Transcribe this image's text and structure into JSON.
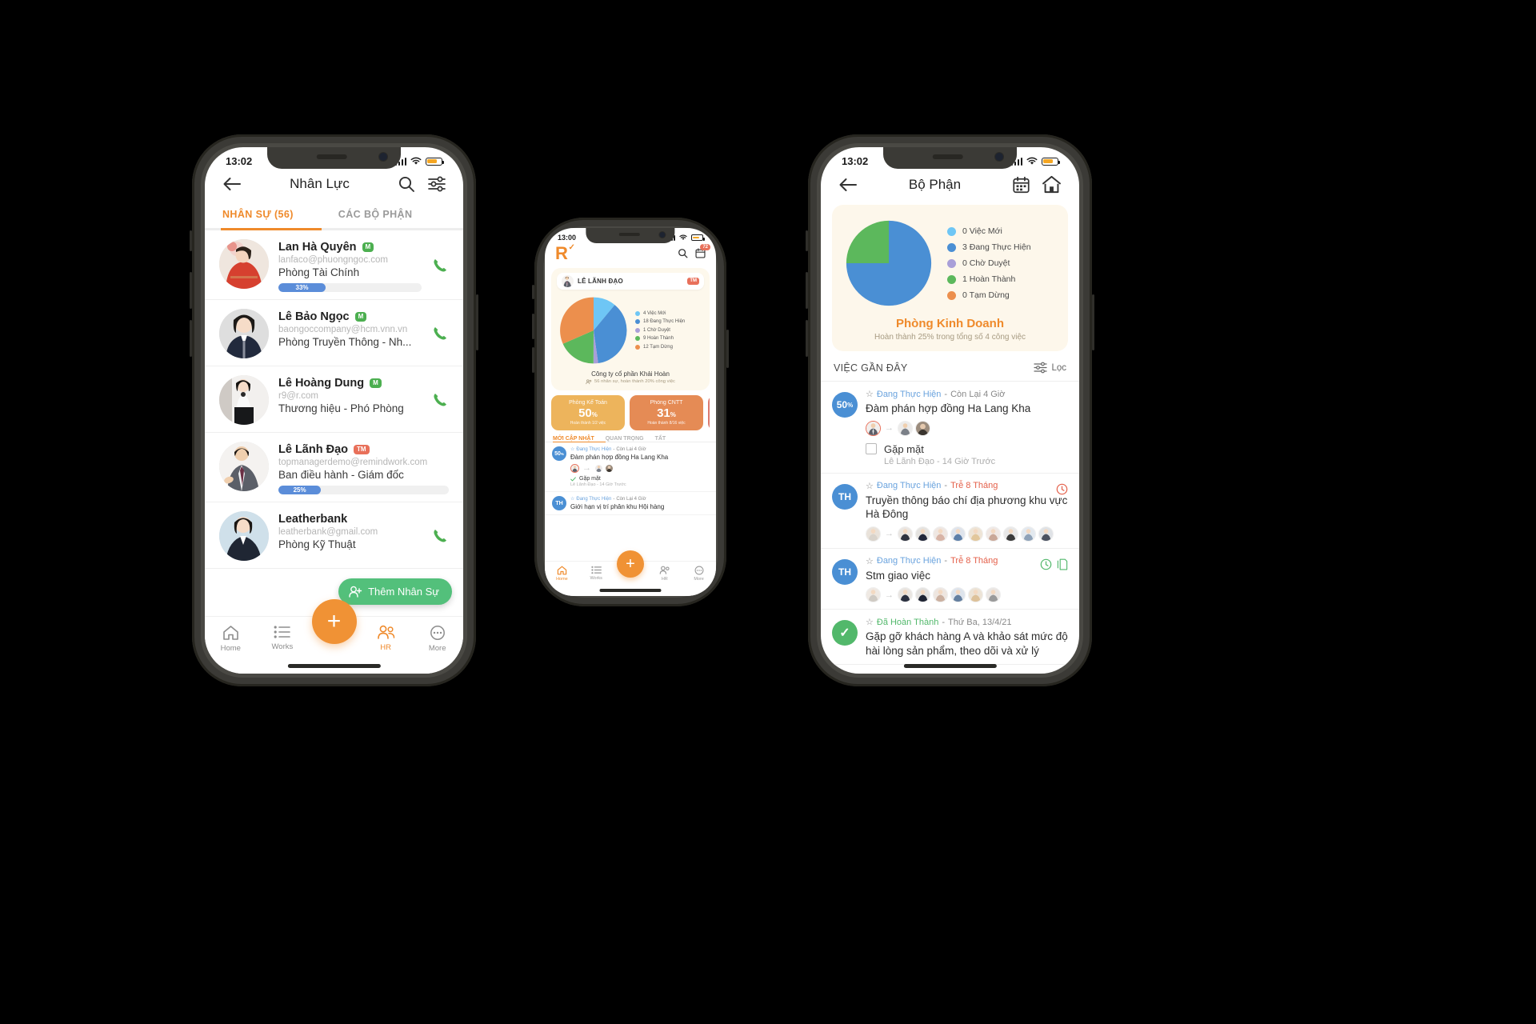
{
  "colors": {
    "orange": "#ef8a2b",
    "green": "#53c07b",
    "blue": "#4a8fd4",
    "light_blue": "#6ec6f5",
    "purple": "#a99fd8",
    "pie_green": "#5cb85c",
    "pie_orange": "#ec8f4d",
    "red": "#e4604a",
    "cream": "#fdf7eb"
  },
  "left_phone": {
    "status": {
      "time": "13:02"
    },
    "header": {
      "title": "Nhân Lực",
      "back_icon": "back-arrow-icon",
      "search_icon": "search-icon",
      "filter_icon": "filter-icon"
    },
    "tabs": [
      {
        "label": "NHÂN SỰ (56)",
        "active": true
      },
      {
        "label": "CÁC BỘ PHẬN",
        "active": false
      }
    ],
    "people": [
      {
        "name": "Lan Hà Quyên",
        "badge": "M",
        "badge_type": "m",
        "email": "lanfaco@phuongngoc.com",
        "dept": "Phòng Tài Chính",
        "progress": 33,
        "progress_label": "33%",
        "has_progress": true,
        "has_phone": true
      },
      {
        "name": "Lê Bảo Ngọc",
        "badge": "M",
        "badge_type": "m",
        "email": "baongoccompany@hcm.vnn.vn",
        "dept": "Phòng Truyền Thông - Nh...",
        "progress": 0,
        "progress_label": "",
        "has_progress": false,
        "has_phone": true
      },
      {
        "name": "Lê Hoàng Dung",
        "badge": "M",
        "badge_type": "m",
        "email": "r9@r.com",
        "dept": "Thương hiệu - Phó Phòng",
        "progress": 0,
        "progress_label": "",
        "has_progress": false,
        "has_phone": true
      },
      {
        "name": "Lê Lãnh Đạo",
        "badge": "TM",
        "badge_type": "tm",
        "email": "topmanagerdemo@remindwork.com",
        "dept": "Ban điều hành - Giám đốc",
        "progress": 25,
        "progress_label": "25%",
        "has_progress": true,
        "has_phone": false
      },
      {
        "name": "Leatherbank",
        "badge": "",
        "badge_type": "",
        "email": "leatherbank@gmail.com",
        "dept": "Phòng Kỹ Thuật",
        "progress": 0,
        "progress_label": "",
        "has_progress": false,
        "has_phone": true
      }
    ],
    "add_button": {
      "label": "Thêm Nhân Sự",
      "icon": "add-person-icon"
    },
    "tabbar": [
      {
        "label": "Home",
        "icon": "home-icon",
        "active": false
      },
      {
        "label": "Works",
        "icon": "list-icon",
        "active": false
      },
      {
        "label": "",
        "icon": "plus-fab-icon",
        "active": false
      },
      {
        "label": "HR",
        "icon": "people-icon",
        "active": true
      },
      {
        "label": "More",
        "icon": "more-icon",
        "active": false
      }
    ]
  },
  "mid_phone": {
    "status": {
      "time": "13:00"
    },
    "header": {
      "logo": "R",
      "search_icon": "search-icon",
      "calendar_icon": "calendar-icon",
      "calendar_badge": "72"
    },
    "card": {
      "owner": "LÊ LÃNH ĐẠO",
      "owner_badge": "TM",
      "legend": [
        {
          "label": "4 Việc Mới",
          "color": "#6ec6f5"
        },
        {
          "label": "18 Đang Thực Hiện",
          "color": "#4a8fd4"
        },
        {
          "label": "1 Chờ Duyệt",
          "color": "#a99fd8"
        },
        {
          "label": "9 Hoàn Thành",
          "color": "#5cb85c"
        },
        {
          "label": "12 Tạm Dừng",
          "color": "#ec8f4d"
        }
      ],
      "company": "Công ty cổ phần Khải Hoàn",
      "company_sub": "56 nhân sự, hoàn thành 20% công việc"
    },
    "tiles": [
      {
        "title": "Phòng Kế Toán",
        "value": "50",
        "unit": "%",
        "sub": "Hoàn thành 1/2 việc"
      },
      {
        "title": "Phòng CNTT",
        "value": "31",
        "unit": "%",
        "sub": "Hoàn thành 8/16 việc"
      },
      {
        "title": "",
        "value": "",
        "unit": "",
        "sub": ""
      }
    ],
    "tabs": [
      {
        "label": "MỚI CẬP NHẬT",
        "active": true
      },
      {
        "label": "QUAN TRỌNG",
        "active": false
      },
      {
        "label": "TẤT",
        "active": false
      }
    ],
    "tasks": [
      {
        "circle": "50",
        "circle_unit": "%",
        "circle_type": "pct",
        "status": "Đang Thực Hiện",
        "sep": "-",
        "due": "Còn Lại 4 Giờ",
        "due_late": false,
        "title": "Đàm phán hợp đồng Ha Lang Kha",
        "faces": 3,
        "sub_title": "Gặp mặt",
        "sub_by": "Lê Lãnh Đạo  -  14 Giờ Trước",
        "sub_done": true
      },
      {
        "circle": "TH",
        "circle_unit": "",
        "circle_type": "txt",
        "status": "Đang Thực Hiện",
        "sep": "-",
        "due": "Còn Lại 4 Giờ",
        "due_late": false,
        "title": "Giới hạn vị trí phân khu Hội hàng",
        "faces": 0,
        "sub_title": "",
        "sub_by": "",
        "sub_done": false
      }
    ],
    "tabbar": [
      {
        "label": "Home",
        "icon": "home-icon",
        "active": true
      },
      {
        "label": "Works",
        "icon": "list-icon",
        "active": false
      },
      {
        "label": "",
        "icon": "plus-fab-icon",
        "active": false
      },
      {
        "label": "HR",
        "icon": "people-icon",
        "active": false
      },
      {
        "label": "More",
        "icon": "more-icon",
        "active": false
      }
    ]
  },
  "right_phone": {
    "status": {
      "time": "13:02"
    },
    "header": {
      "title": "Bộ Phận",
      "back_icon": "back-arrow-icon",
      "calendar_icon": "calendar-icon",
      "home_icon": "home-icon"
    },
    "card": {
      "legend": [
        {
          "label": "0 Việc Mới",
          "color": "#6ec6f5"
        },
        {
          "label": "3 Đang Thực Hiện",
          "color": "#4a8fd4"
        },
        {
          "label": "0 Chờ Duyệt",
          "color": "#a99fd8"
        },
        {
          "label": "1 Hoàn Thành",
          "color": "#5cb85c"
        },
        {
          "label": "0 Tạm Dừng",
          "color": "#ec8f4d"
        }
      ],
      "dept": "Phòng Kinh Doanh",
      "dept_sub": "Hoàn thành 25% trong tổng số 4 công việc"
    },
    "section": {
      "title": "VIỆC GẦN ĐÂY",
      "filter_label": "Lọc",
      "filter_icon": "filter-icon"
    },
    "tasks": [
      {
        "circle": "50",
        "circle_unit": "%",
        "circle_type": "pct",
        "status": "Đang Thực Hiện",
        "sep": "-",
        "due": "Còn Lại 4 Giờ",
        "due_late": false,
        "title": "Đàm phán hợp đồng Ha Lang Kha",
        "faces": 3,
        "sub_title": "Gặp mặt",
        "sub_by": "Lê Lãnh Đạo  -  14 Giờ Trước",
        "has_clock": false,
        "has_doc": false
      },
      {
        "circle": "TH",
        "circle_unit": "",
        "circle_type": "txt",
        "status": "Đang Thực Hiện",
        "sep": "-",
        "due": "Trễ 8 Tháng",
        "due_late": true,
        "title": "Truyền thông báo chí địa phương khu vực Hà Đông",
        "faces": 10,
        "sub_title": "",
        "sub_by": "",
        "has_clock": true,
        "has_doc": false
      },
      {
        "circle": "TH",
        "circle_unit": "",
        "circle_type": "txt",
        "status": "Đang Thực Hiện",
        "sep": "-",
        "due": "Trễ 8 Tháng",
        "due_late": true,
        "title": "Stm giao việc",
        "faces": 7,
        "sub_title": "",
        "sub_by": "",
        "has_clock": true,
        "has_doc": true
      },
      {
        "circle": "✓",
        "circle_unit": "",
        "circle_type": "check",
        "status": "Đã Hoàn Thành",
        "sep": "-",
        "due": "Thứ Ba, 13/4/21",
        "due_late": false,
        "title": "Gặp gỡ khách hàng A và khảo sát mức độ hài lòng sản phẩm, theo dõi và xử lý",
        "faces": 0,
        "sub_title": "",
        "sub_by": "",
        "has_clock": false,
        "has_doc": false
      }
    ]
  },
  "chart_data": [
    {
      "type": "pie",
      "title": "Công ty cổ phần Khải Hoàn",
      "legend_position": "right",
      "categories": [
        "Việc Mới",
        "Đang Thực Hiện",
        "Chờ Duyệt",
        "Hoàn Thành",
        "Tạm Dừng"
      ],
      "values": [
        4,
        18,
        1,
        9,
        12
      ],
      "colors": [
        "#6ec6f5",
        "#4a8fd4",
        "#a99fd8",
        "#5cb85c",
        "#ec8f4d"
      ]
    },
    {
      "type": "pie",
      "title": "Phòng Kinh Doanh",
      "legend_position": "right",
      "categories": [
        "Việc Mới",
        "Đang Thực Hiện",
        "Chờ Duyệt",
        "Hoàn Thành",
        "Tạm Dừng"
      ],
      "values": [
        0,
        3,
        0,
        1,
        0
      ],
      "colors": [
        "#6ec6f5",
        "#4a8fd4",
        "#a99fd8",
        "#5cb85c",
        "#ec8f4d"
      ]
    }
  ]
}
